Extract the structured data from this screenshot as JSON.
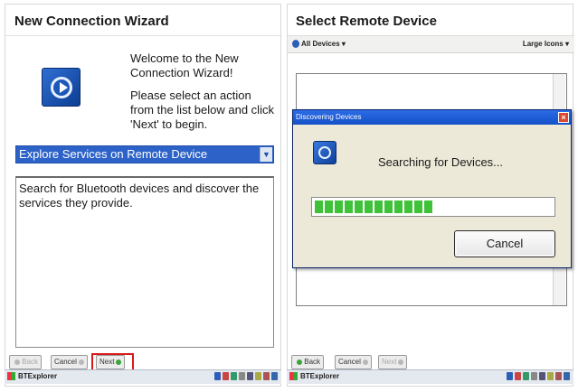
{
  "left": {
    "title": "New Connection Wizard",
    "welcome": "Welcome to the New Connection Wizard!",
    "instruction": "Please select an action from the list below and click 'Next' to begin.",
    "selected_action": "Explore Services on Remote Device",
    "description": "Search for Bluetooth devices and discover the services they provide.",
    "buttons": {
      "back": "Back",
      "cancel": "Cancel",
      "next": "Next"
    },
    "taskbar_app": "BTExplorer"
  },
  "right": {
    "title": "Select Remote Device",
    "filter": "All Devices",
    "view": "Large Icons",
    "dialog": {
      "title": "Discovering Devices",
      "message": "Searching for Devices...",
      "progress": 0.5,
      "cancel": "Cancel"
    },
    "buttons": {
      "back": "Back",
      "cancel": "Cancel",
      "next": "Next"
    },
    "taskbar_app": "BTExplorer"
  },
  "colors": {
    "highlight_box": "#d81a1a",
    "progress_fill": "#3fc23a",
    "title_bar": "#1450c8",
    "selection": "#2d63c8"
  }
}
